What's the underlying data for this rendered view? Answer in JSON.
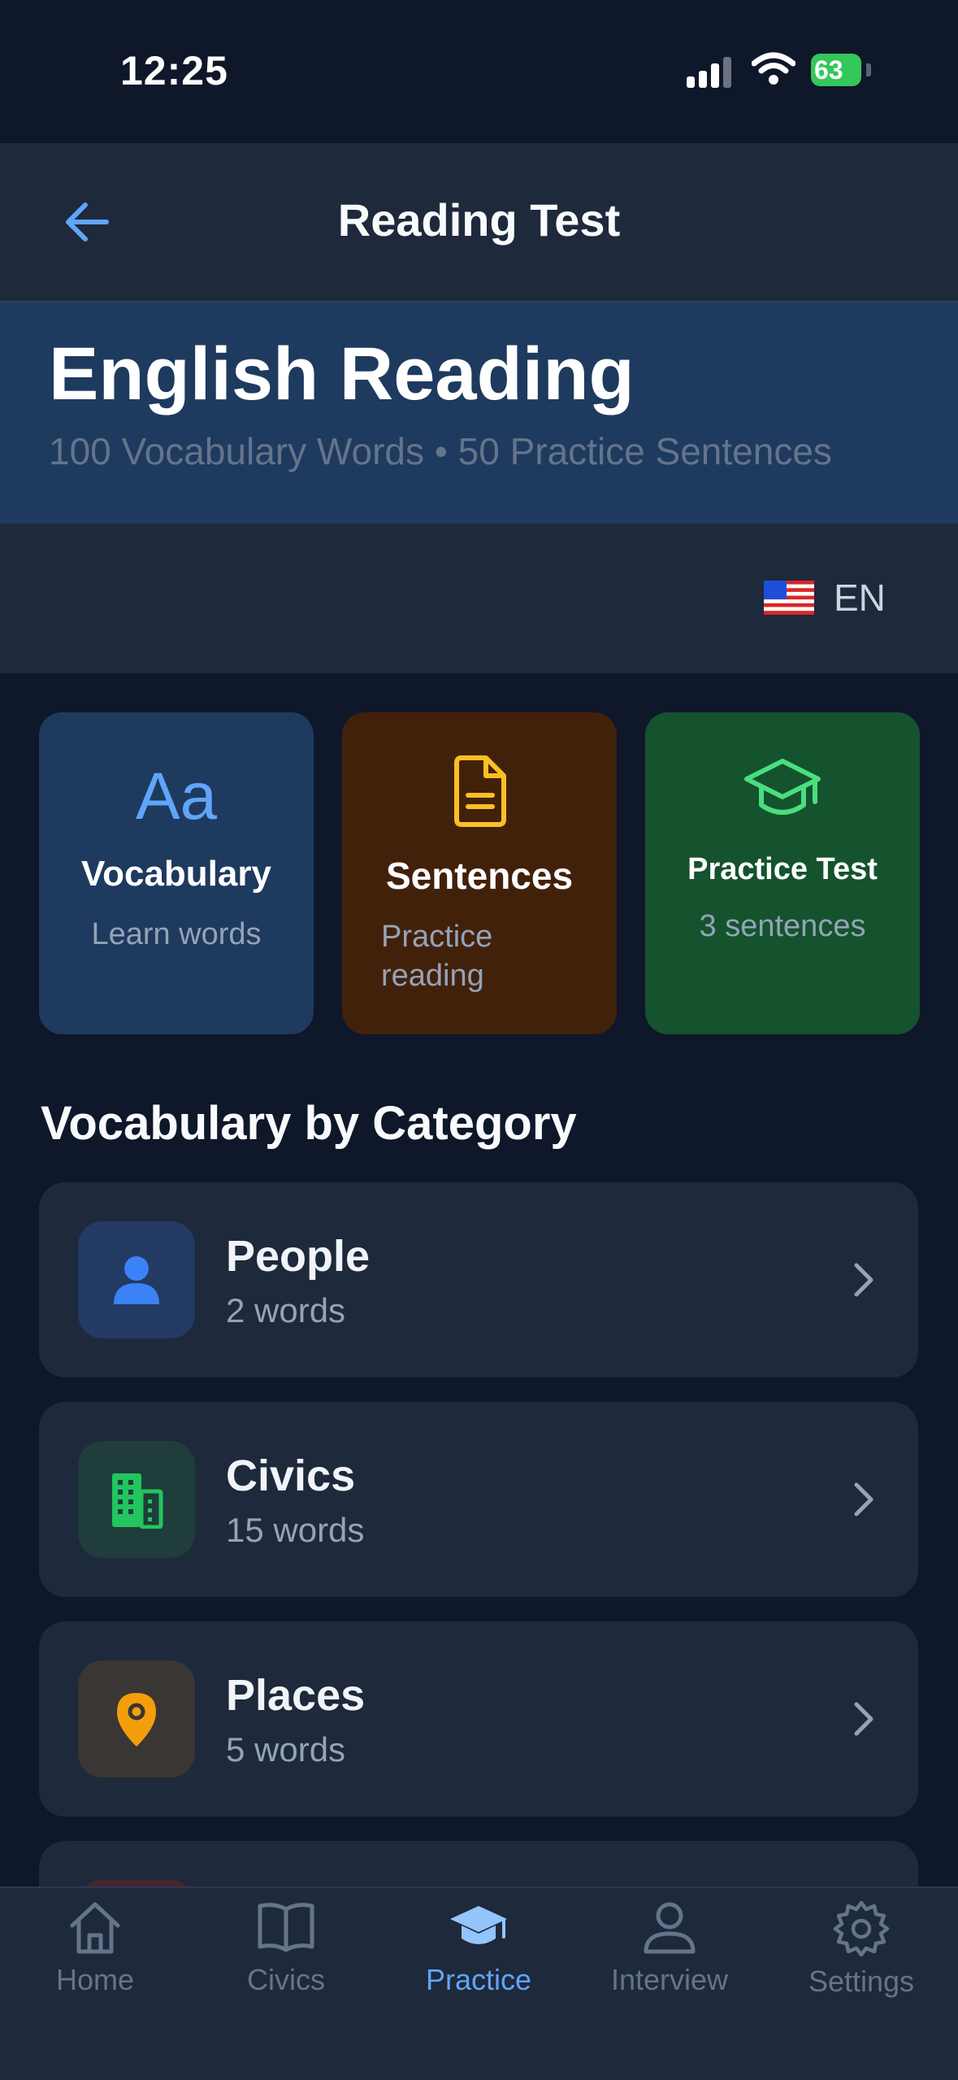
{
  "status_bar": {
    "time": "12:25",
    "battery": "63"
  },
  "header": {
    "title": "Reading Test",
    "back_icon": "arrow-left-icon"
  },
  "hero": {
    "title": "English Reading",
    "subtitle": "100 Vocabulary Words • 50 Practice Sentences"
  },
  "language": {
    "flag": "us-flag-icon",
    "code": "EN"
  },
  "mode_cards": [
    {
      "icon": "text-aa-icon",
      "title": "Vocabulary",
      "subtitle": "Learn words",
      "accent": "#60a5fa"
    },
    {
      "icon": "document-icon",
      "title": "Sentences",
      "subtitle": "Practice reading",
      "accent": "#fbbf24"
    },
    {
      "icon": "graduation-cap-icon",
      "title": "Practice Test",
      "subtitle": "3 sentences",
      "accent": "#4ade80"
    }
  ],
  "section_title": "Vocabulary by Category",
  "categories": [
    {
      "icon": "person-icon",
      "name": "People",
      "count": "2 words",
      "color": "#3b82f6"
    },
    {
      "icon": "building-icon",
      "name": "Civics",
      "count": "15 words",
      "color": "#22c55e"
    },
    {
      "icon": "location-pin-icon",
      "name": "Places",
      "count": "5 words",
      "color": "#f59e0b"
    }
  ],
  "tabs": [
    {
      "icon": "home-icon",
      "label": "Home",
      "active": false
    },
    {
      "icon": "book-icon",
      "label": "Civics",
      "active": false
    },
    {
      "icon": "graduation-cap-icon",
      "label": "Practice",
      "active": true
    },
    {
      "icon": "person-icon",
      "label": "Interview",
      "active": false
    },
    {
      "icon": "gear-icon",
      "label": "Settings",
      "active": false
    }
  ]
}
